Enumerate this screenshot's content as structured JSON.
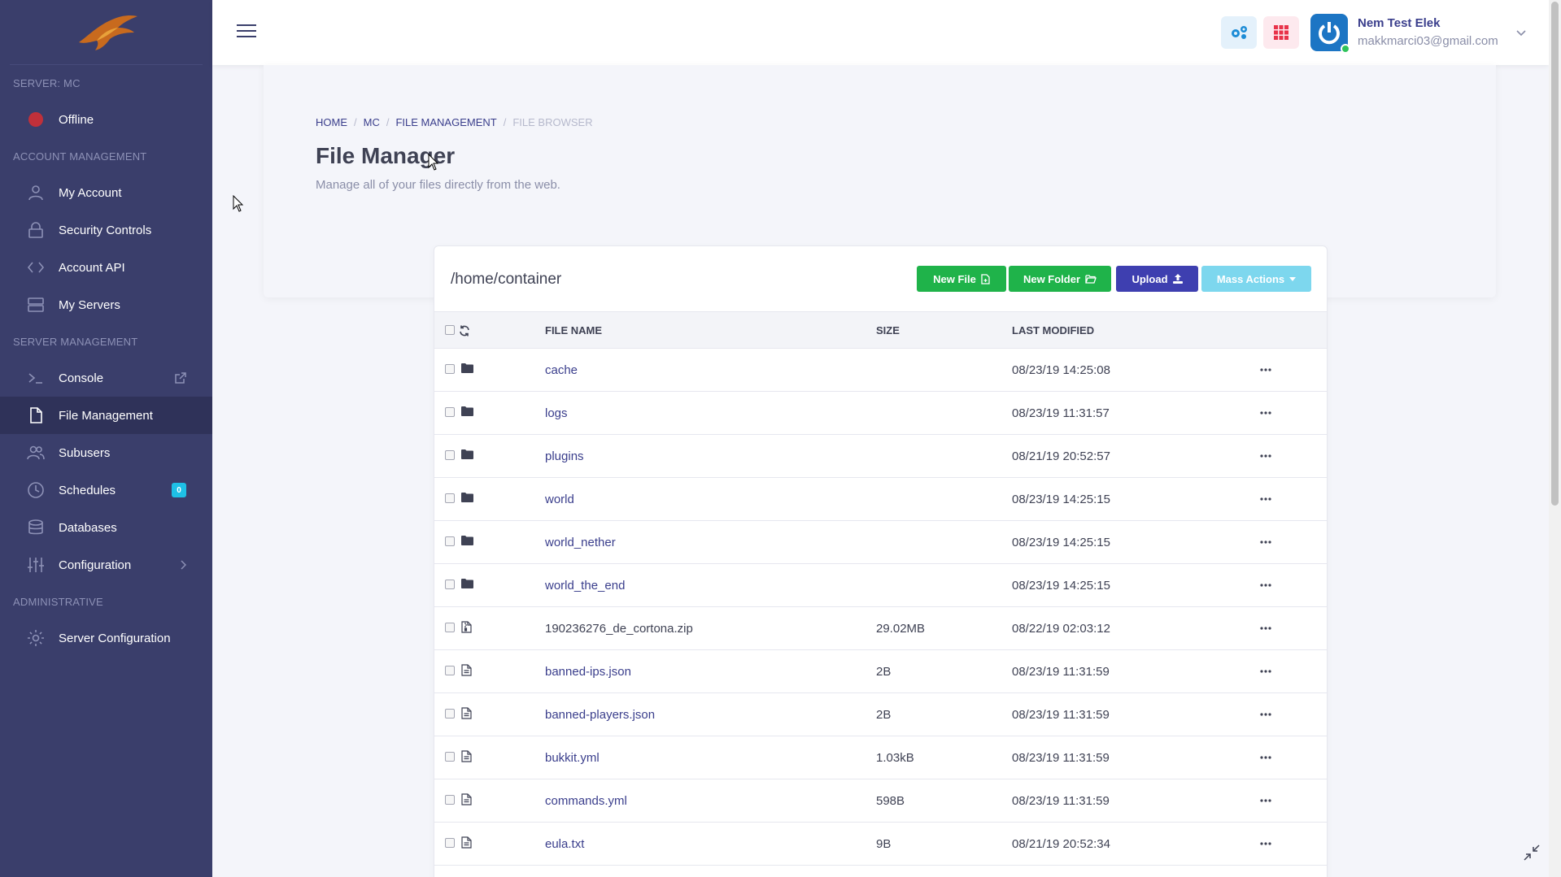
{
  "sidebar": {
    "sections": {
      "server": "SERVER: MC",
      "account": "ACCOUNT MANAGEMENT",
      "server_mgmt": "SERVER MANAGEMENT",
      "admin": "ADMINISTRATIVE"
    },
    "status": "Offline",
    "items": {
      "my_account": "My Account",
      "security": "Security Controls",
      "api": "Account API",
      "servers": "My Servers",
      "console": "Console",
      "files": "File Management",
      "subusers": "Subusers",
      "schedules": "Schedules",
      "schedules_badge": "0",
      "databases": "Databases",
      "configuration": "Configuration",
      "server_config": "Server Configuration"
    }
  },
  "header": {
    "user_name": "Nem Test Elek",
    "user_email": "makkmarci03@gmail.com"
  },
  "breadcrumb": [
    "HOME",
    "MC",
    "FILE MANAGEMENT",
    "FILE BROWSER"
  ],
  "page": {
    "title": "File Manager",
    "subtitle": "Manage all of your files directly from the web."
  },
  "file_manager": {
    "path": "/home/container",
    "buttons": {
      "new_file": "New File",
      "new_folder": "New Folder",
      "upload": "Upload",
      "mass_actions": "Mass Actions"
    },
    "columns": {
      "name": "FILE NAME",
      "size": "SIZE",
      "modified": "LAST MODIFIED"
    },
    "rows": [
      {
        "name": "cache",
        "size": "",
        "modified": "08/23/19 14:25:08",
        "type": "folder"
      },
      {
        "name": "logs",
        "size": "",
        "modified": "08/23/19 11:31:57",
        "type": "folder"
      },
      {
        "name": "plugins",
        "size": "",
        "modified": "08/21/19 20:52:57",
        "type": "folder"
      },
      {
        "name": "world",
        "size": "",
        "modified": "08/23/19 14:25:15",
        "type": "folder"
      },
      {
        "name": "world_nether",
        "size": "",
        "modified": "08/23/19 14:25:15",
        "type": "folder"
      },
      {
        "name": "world_the_end",
        "size": "",
        "modified": "08/23/19 14:25:15",
        "type": "folder"
      },
      {
        "name": "190236276_de_cortona.zip",
        "size": "29.02MB",
        "modified": "08/22/19 02:03:12",
        "type": "archive"
      },
      {
        "name": "banned-ips.json",
        "size": "2B",
        "modified": "08/23/19 11:31:59",
        "type": "file"
      },
      {
        "name": "banned-players.json",
        "size": "2B",
        "modified": "08/23/19 11:31:59",
        "type": "file"
      },
      {
        "name": "bukkit.yml",
        "size": "1.03kB",
        "modified": "08/23/19 11:31:59",
        "type": "file"
      },
      {
        "name": "commands.yml",
        "size": "598B",
        "modified": "08/23/19 11:31:59",
        "type": "file"
      },
      {
        "name": "eula.txt",
        "size": "9B",
        "modified": "08/21/19 20:52:34",
        "type": "file"
      }
    ]
  },
  "colors": {
    "sidebar_bg": "#3a3e6b",
    "accent": "#3a3e8c",
    "green": "#1fb34a",
    "blue": "#3e3fb0",
    "cyan": "#7dd7ee",
    "offline": "#c0303a"
  }
}
